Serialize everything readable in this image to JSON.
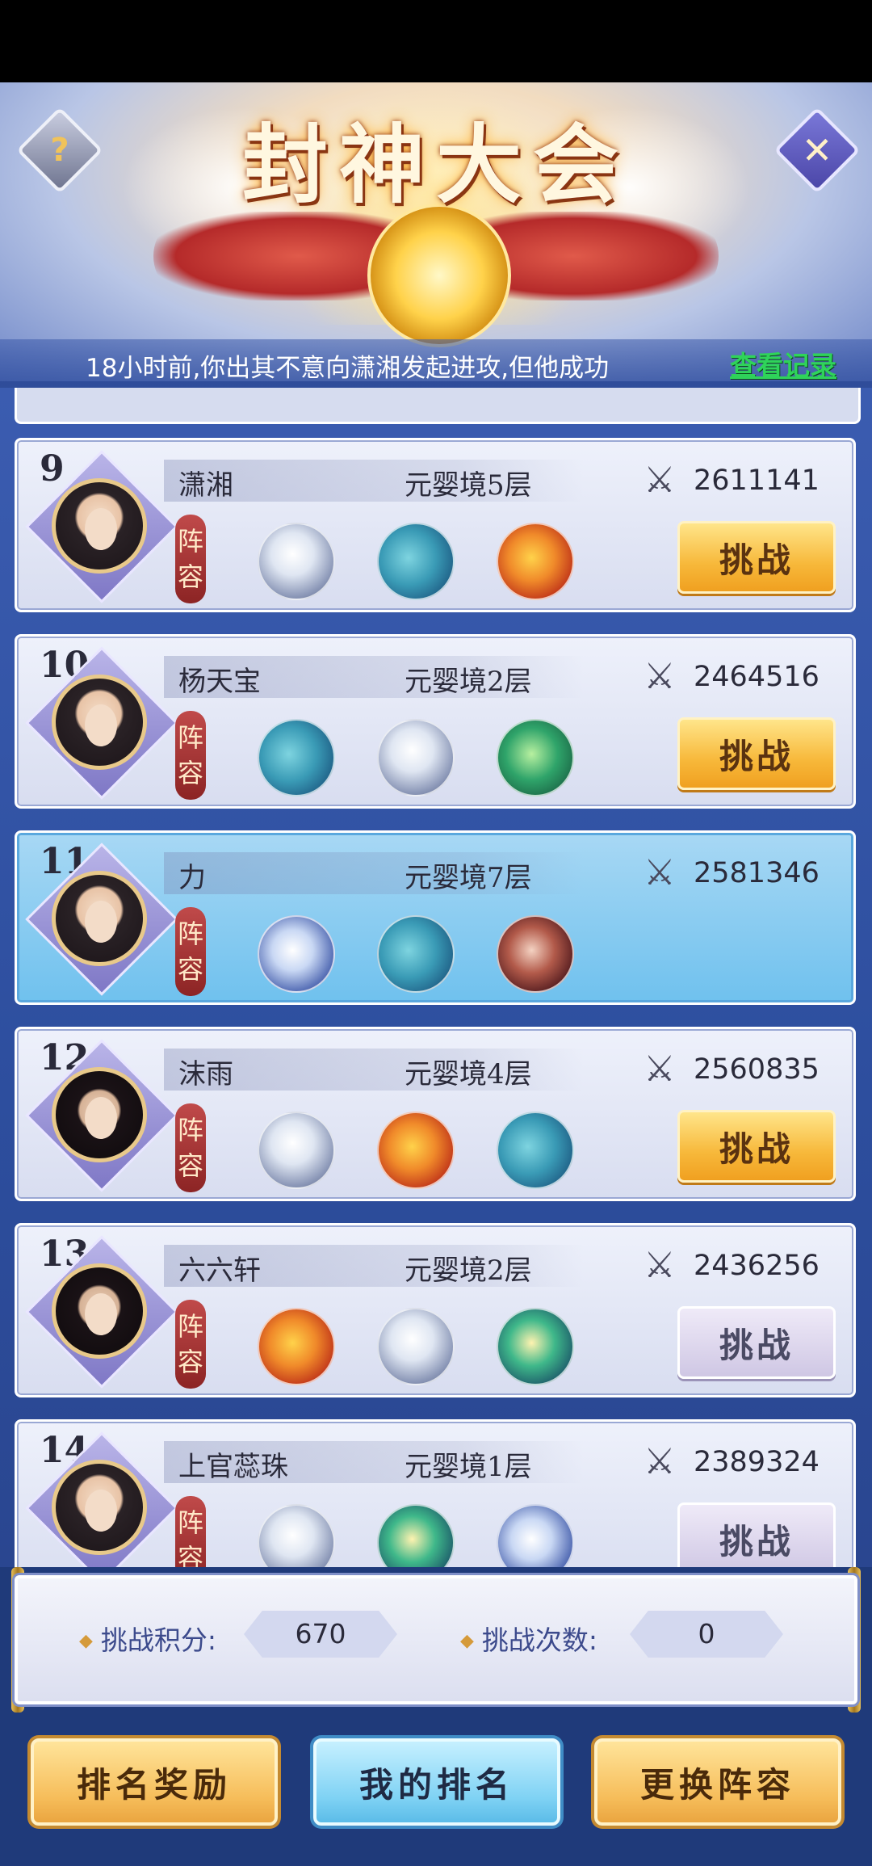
{
  "header": {
    "title": "封神大会",
    "help_icon": "?",
    "close_icon": "✕"
  },
  "news": {
    "text": "18小时前,你出其不意向潇湘发起进攻,但他成功",
    "link": "查看记录"
  },
  "ranking": {
    "lineup_label": "阵容",
    "entries": [
      {
        "rank": "9",
        "name": "潇湘",
        "realm": "元婴境5层",
        "power": "2611141",
        "pets": [
          "tiger",
          "whale",
          "fire"
        ],
        "avatar": "female",
        "button": "挑战",
        "button_state": "active"
      },
      {
        "rank": "10",
        "name": "杨天宝",
        "realm": "元婴境2层",
        "power": "2464516",
        "pets": [
          "whale",
          "tiger",
          "green"
        ],
        "avatar": "female",
        "button": "挑战",
        "button_state": "active"
      },
      {
        "rank": "11",
        "name": "力",
        "realm": "元婴境7层",
        "power": "2581346",
        "pets": [
          "serpent",
          "whale",
          "skull"
        ],
        "avatar": "female",
        "button": "",
        "button_state": "self"
      },
      {
        "rank": "12",
        "name": "沫雨",
        "realm": "元婴境4层",
        "power": "2560835",
        "pets": [
          "tiger",
          "fire",
          "whale"
        ],
        "avatar": "male",
        "button": "挑战",
        "button_state": "active"
      },
      {
        "rank": "13",
        "name": "六六轩",
        "realm": "元婴境2层",
        "power": "2436256",
        "pets": [
          "fire",
          "tiger",
          "jade"
        ],
        "avatar": "male",
        "button": "挑战",
        "button_state": "disabled"
      },
      {
        "rank": "14",
        "name": "上官蕊珠",
        "realm": "元婴境1层",
        "power": "2389324",
        "pets": [
          "tiger",
          "jade",
          "serpent"
        ],
        "avatar": "female",
        "button": "挑战",
        "button_state": "disabled"
      }
    ]
  },
  "stats": {
    "score_label": "挑战积分:",
    "score_value": "670",
    "times_label": "挑战次数:",
    "times_value": "0"
  },
  "buttons": {
    "reward": "排名奖励",
    "my_rank": "我的排名",
    "change_lineup": "更换阵容"
  }
}
